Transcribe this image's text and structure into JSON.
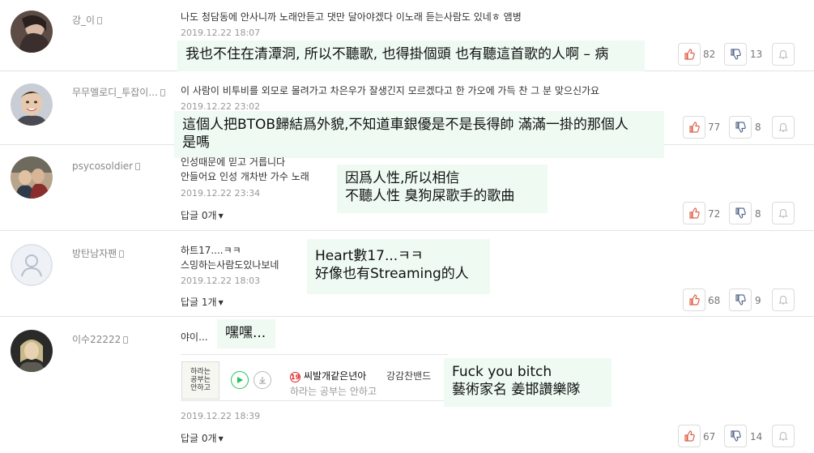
{
  "comments": [
    {
      "username": "강_이",
      "text_lines": [
        "나도 청담동에 안사니까 노래안듣고 댓만 달아야겠다 이노래 듣는사람도 있네ㅎ 앰병"
      ],
      "date": "2019.12.22 18:07",
      "replies": "",
      "likes": "82",
      "dislikes": "13",
      "translation": [
        "我也不住在清潭洞, 所以不聽歌, 也得掛個頭 也有聽這首歌的人啊 – 病"
      ]
    },
    {
      "username": "무무멜로디_투잡이...",
      "text_lines": [
        "이 사람이 비투비를 외모로 몰려가고 차은우가 잘생긴지 모르겠다고 한 가오에 가득 찬 그 분 맞으신가요"
      ],
      "date": "2019.12.22 23:02",
      "replies": "",
      "likes": "77",
      "dislikes": "8",
      "translation": [
        "這個人把BTOB歸結爲外貌,不知道車銀優是不是長得帥 滿滿一掛的那個人",
        "是嗎"
      ]
    },
    {
      "username": "psycosoldier",
      "text_lines": [
        "인성때문에 믿고 거릅니다",
        "안들어요 인성 개차반 가수 노래"
      ],
      "date": "2019.12.22 23:34",
      "replies": "답글 0개",
      "likes": "72",
      "dislikes": "8",
      "translation": [
        "因爲人性,所以相信",
        "不聽人性 臭狗屎歌手的歌曲"
      ]
    },
    {
      "username": "방탄남자팬",
      "text_lines": [
        "하트17....ㅋㅋ",
        "스밍하는사람도있나보네"
      ],
      "date": "2019.12.22 18:03",
      "replies": "답글 1개",
      "likes": "68",
      "dislikes": "9",
      "translation": [
        "Heart數17...ㅋㅋ",
        "好像也有Streaming的人"
      ]
    },
    {
      "username": "이수22222",
      "text_lines": [
        "야이..."
      ],
      "date": "2019.12.22 18:39",
      "replies": "답글 0개",
      "likes": "67",
      "dislikes": "14",
      "translation": [
        "嘿嘿..."
      ]
    }
  ],
  "music_card": {
    "album_text": "하라는\n공부는\n안하고",
    "age_badge": "19",
    "title": "씨발개같은년아",
    "artist": "강감찬밴드",
    "lyric": "하라는 공부는 안하고",
    "translation": [
      "Fuck you bitch",
      "藝術家名 姜邯讚樂隊"
    ]
  },
  "colors": {
    "translation_bg": "#eefaf2",
    "like_icon": "#e0604a",
    "dislike_icon": "#5a6b8c",
    "play_green": "#23c25a"
  }
}
